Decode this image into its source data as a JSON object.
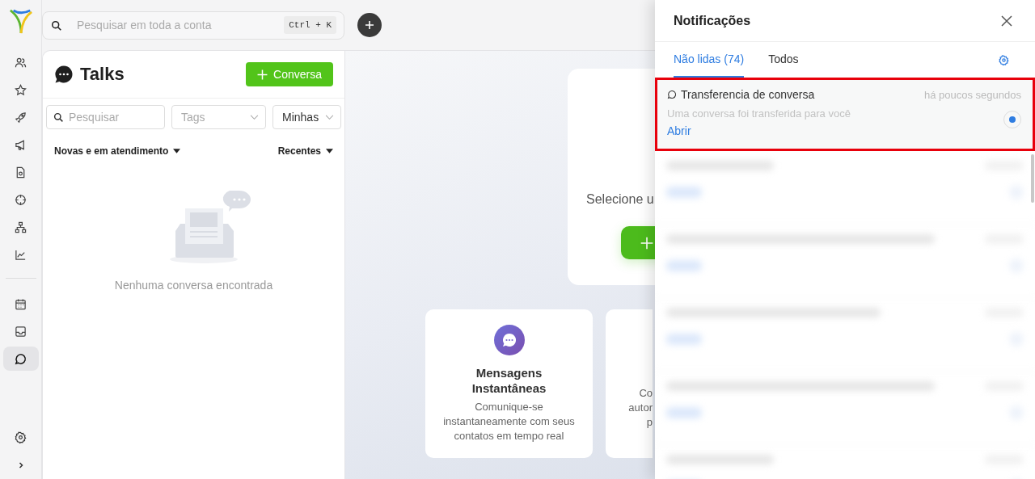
{
  "nav": {
    "groups": [
      [
        {
          "kind": "users",
          "selected": false
        },
        {
          "kind": "star",
          "selected": false
        },
        {
          "kind": "rocket",
          "selected": false
        },
        {
          "kind": "megaphone",
          "selected": false
        },
        {
          "kind": "document",
          "selected": false
        },
        {
          "kind": "target",
          "selected": false
        },
        {
          "kind": "hierarchy",
          "selected": false
        },
        {
          "kind": "chart",
          "selected": false
        }
      ],
      [
        {
          "kind": "calendar",
          "selected": false
        },
        {
          "kind": "inbox",
          "selected": false
        },
        {
          "kind": "chat",
          "selected": true
        }
      ]
    ]
  },
  "search": {
    "placeholder": "Pesquisar em toda a conta",
    "shortcut": "Ctrl + K"
  },
  "talks": {
    "title": "Talks",
    "new_button": "Conversa",
    "search_placeholder": "Pesquisar",
    "tags_placeholder": "Tags",
    "owner_filter": "Minhas",
    "status_sort": "Novas e em atendimento",
    "order_sort": "Recentes",
    "empty_text": "Nenhuma conversa encontrada"
  },
  "welcome": {
    "prompt": "Selecione u"
  },
  "features": [
    {
      "kind": "full",
      "title": "Mensagens Instantâneas",
      "description": "Comunique-se instantaneamente com seus contatos em tempo real"
    },
    {
      "kind": "cut",
      "lines": [
        "Co",
        "autor",
        "p"
      ]
    }
  ],
  "notifications": {
    "title": "Notificações",
    "tabs": [
      {
        "label": "Não lidas (74)",
        "selected": true
      },
      {
        "label": "Todos",
        "selected": false
      }
    ],
    "items": [
      {
        "title": "Transferencia de conversa",
        "time": "há poucos segundos",
        "message": "Uma conversa foi transferida para você",
        "action": "Abrir",
        "unread": true,
        "highlighted": true
      }
    ]
  }
}
